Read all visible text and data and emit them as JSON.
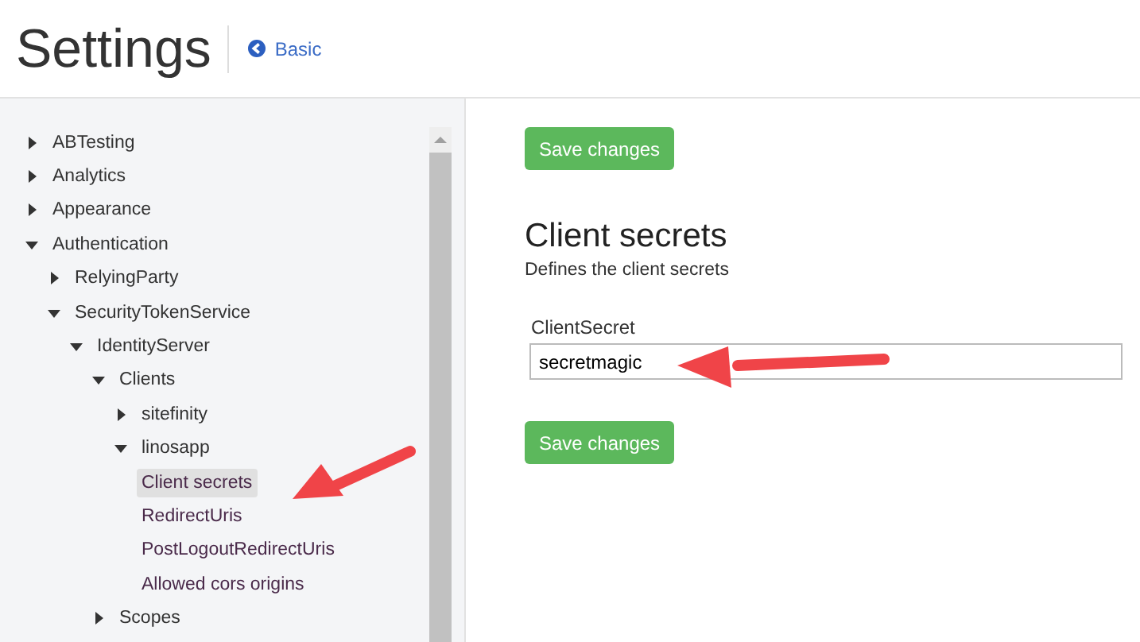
{
  "header": {
    "title": "Settings",
    "back_link": "Basic"
  },
  "tree": [
    {
      "label": "ABTesting",
      "expanded": false,
      "selected": false
    },
    {
      "label": "Analytics",
      "expanded": false,
      "selected": false
    },
    {
      "label": "Appearance",
      "expanded": false,
      "selected": false
    },
    {
      "label": "Authentication",
      "expanded": true,
      "selected": false,
      "children": [
        {
          "label": "RelyingParty",
          "expanded": false,
          "selected": false
        },
        {
          "label": "SecurityTokenService",
          "expanded": true,
          "selected": false,
          "children": [
            {
              "label": "IdentityServer",
              "expanded": true,
              "selected": false,
              "children": [
                {
                  "label": "Clients",
                  "expanded": true,
                  "selected": false,
                  "children": [
                    {
                      "label": "sitefinity",
                      "expanded": false,
                      "selected": false
                    },
                    {
                      "label": "linosapp",
                      "expanded": true,
                      "selected": false,
                      "children": [
                        {
                          "label": "Client secrets",
                          "selected": true
                        },
                        {
                          "label": "RedirectUris",
                          "selected": false
                        },
                        {
                          "label": "PostLogoutRedirectUris",
                          "selected": false
                        },
                        {
                          "label": "Allowed cors origins",
                          "selected": false
                        }
                      ]
                    }
                  ]
                },
                {
                  "label": "Scopes",
                  "expanded": false,
                  "selected": false
                }
              ]
            }
          ]
        }
      ]
    }
  ],
  "content": {
    "save_button": "Save changes",
    "heading": "Client secrets",
    "description": "Defines the client secrets",
    "field": {
      "label": "ClientSecret",
      "value": "secretmagic"
    },
    "save_button_bottom": "Save changes"
  }
}
